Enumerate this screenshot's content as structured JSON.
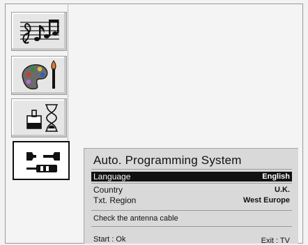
{
  "sidebar": {
    "tabs": [
      {
        "icon": "music-notes-icon"
      },
      {
        "icon": "paint-palette-icon"
      },
      {
        "icon": "lock-hourglass-icon"
      },
      {
        "icon": "wrench-screwdriver-icon"
      }
    ],
    "selected_index": 3
  },
  "panel": {
    "title": "Auto. Programming System",
    "rows": [
      {
        "label": "Language",
        "value": "English",
        "selected": true
      },
      {
        "label": "Country",
        "value": "U.K.",
        "selected": false
      },
      {
        "label": "Txt. Region",
        "value": "West Europe",
        "selected": false
      }
    ],
    "message": "Check the antenna cable",
    "footer": {
      "start": "Start : Ok",
      "exit": "Exit : TV"
    }
  },
  "colors": {
    "background": "#f2f2f2",
    "panel": "#d9d9d9",
    "selection": "#111111"
  }
}
